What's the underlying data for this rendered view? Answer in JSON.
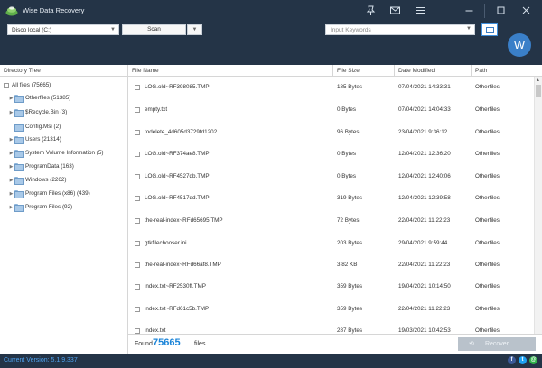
{
  "window": {
    "title": "Wise Data Recovery",
    "controls": [
      "pin-icon",
      "mail-icon",
      "menu-icon",
      "minimize-icon",
      "maximize-icon",
      "close-icon"
    ]
  },
  "toolbar": {
    "drive": "Disco local (C:)",
    "scan_label": "Scan",
    "search_placeholder": "Input Keywords",
    "avatar_letter": "W"
  },
  "tree": {
    "header": "Directory Tree",
    "items": [
      {
        "label": "All files (75665)"
      },
      {
        "label": "Otherfiles (51385)"
      },
      {
        "label": "$Recycle.Bin (3)"
      },
      {
        "label": "Config.Msi (2)"
      },
      {
        "label": "Users (21314)"
      },
      {
        "label": "System Volume Information (5)"
      },
      {
        "label": "ProgramData (163)"
      },
      {
        "label": "Windows (2262)"
      },
      {
        "label": "Program Files (x86) (439)"
      },
      {
        "label": "Program Files (92)"
      }
    ]
  },
  "files": {
    "columns": {
      "name": "File Name",
      "size": "File Size",
      "date": "Date Modified",
      "path": "Path"
    },
    "rows": [
      {
        "name": "LOG.old~RF398085.TMP",
        "size": "185 Bytes",
        "date": "07/04/2021 14:33:31",
        "path": "Otherfiles"
      },
      {
        "name": "empty.txt",
        "size": "0 Bytes",
        "date": "07/04/2021 14:04:33",
        "path": "Otherfiles"
      },
      {
        "name": "todelete_4d605d3729fd1202",
        "size": "96 Bytes",
        "date": "23/04/2021 9:36:12",
        "path": "Otherfiles"
      },
      {
        "name": "LOG.old~RF374ae8.TMP",
        "size": "0 Bytes",
        "date": "12/04/2021 12:36:20",
        "path": "Otherfiles"
      },
      {
        "name": "LOG.old~RF4527db.TMP",
        "size": "0 Bytes",
        "date": "12/04/2021 12:40:06",
        "path": "Otherfiles"
      },
      {
        "name": "LOG.old~RF4517dd.TMP",
        "size": "319 Bytes",
        "date": "12/04/2021 12:39:58",
        "path": "Otherfiles"
      },
      {
        "name": "the-real-index~RFd65695.TMP",
        "size": "72 Bytes",
        "date": "22/04/2021 11:22:23",
        "path": "Otherfiles"
      },
      {
        "name": "gtkfilechooser.ini",
        "size": "203 Bytes",
        "date": "29/04/2021 9:59:44",
        "path": "Otherfiles"
      },
      {
        "name": "the-real-index~RFd66af8.TMP",
        "size": "3,82 KB",
        "date": "22/04/2021 11:22:23",
        "path": "Otherfiles"
      },
      {
        "name": "index.txt~RF2530ff.TMP",
        "size": "359 Bytes",
        "date": "19/04/2021 10:14:50",
        "path": "Otherfiles"
      },
      {
        "name": "index.txt~RFd61c5b.TMP",
        "size": "359 Bytes",
        "date": "22/04/2021 11:22:23",
        "path": "Otherfiles"
      },
      {
        "name": "index.txt",
        "size": "287 Bytes",
        "date": "19/03/2021 10:42:53",
        "path": "Otherfiles"
      }
    ]
  },
  "footer": {
    "found_prefix": "Found",
    "found_count": "75665",
    "found_suffix": "files.",
    "recover_label": "Recover"
  },
  "status": {
    "version": "Current Version: 5.1.9.337",
    "social": [
      "facebook-icon",
      "twitter-icon",
      "email-icon"
    ]
  },
  "colors": {
    "chrome": "#243447",
    "accent": "#1b84d8",
    "folder": "#a9c9e8"
  }
}
